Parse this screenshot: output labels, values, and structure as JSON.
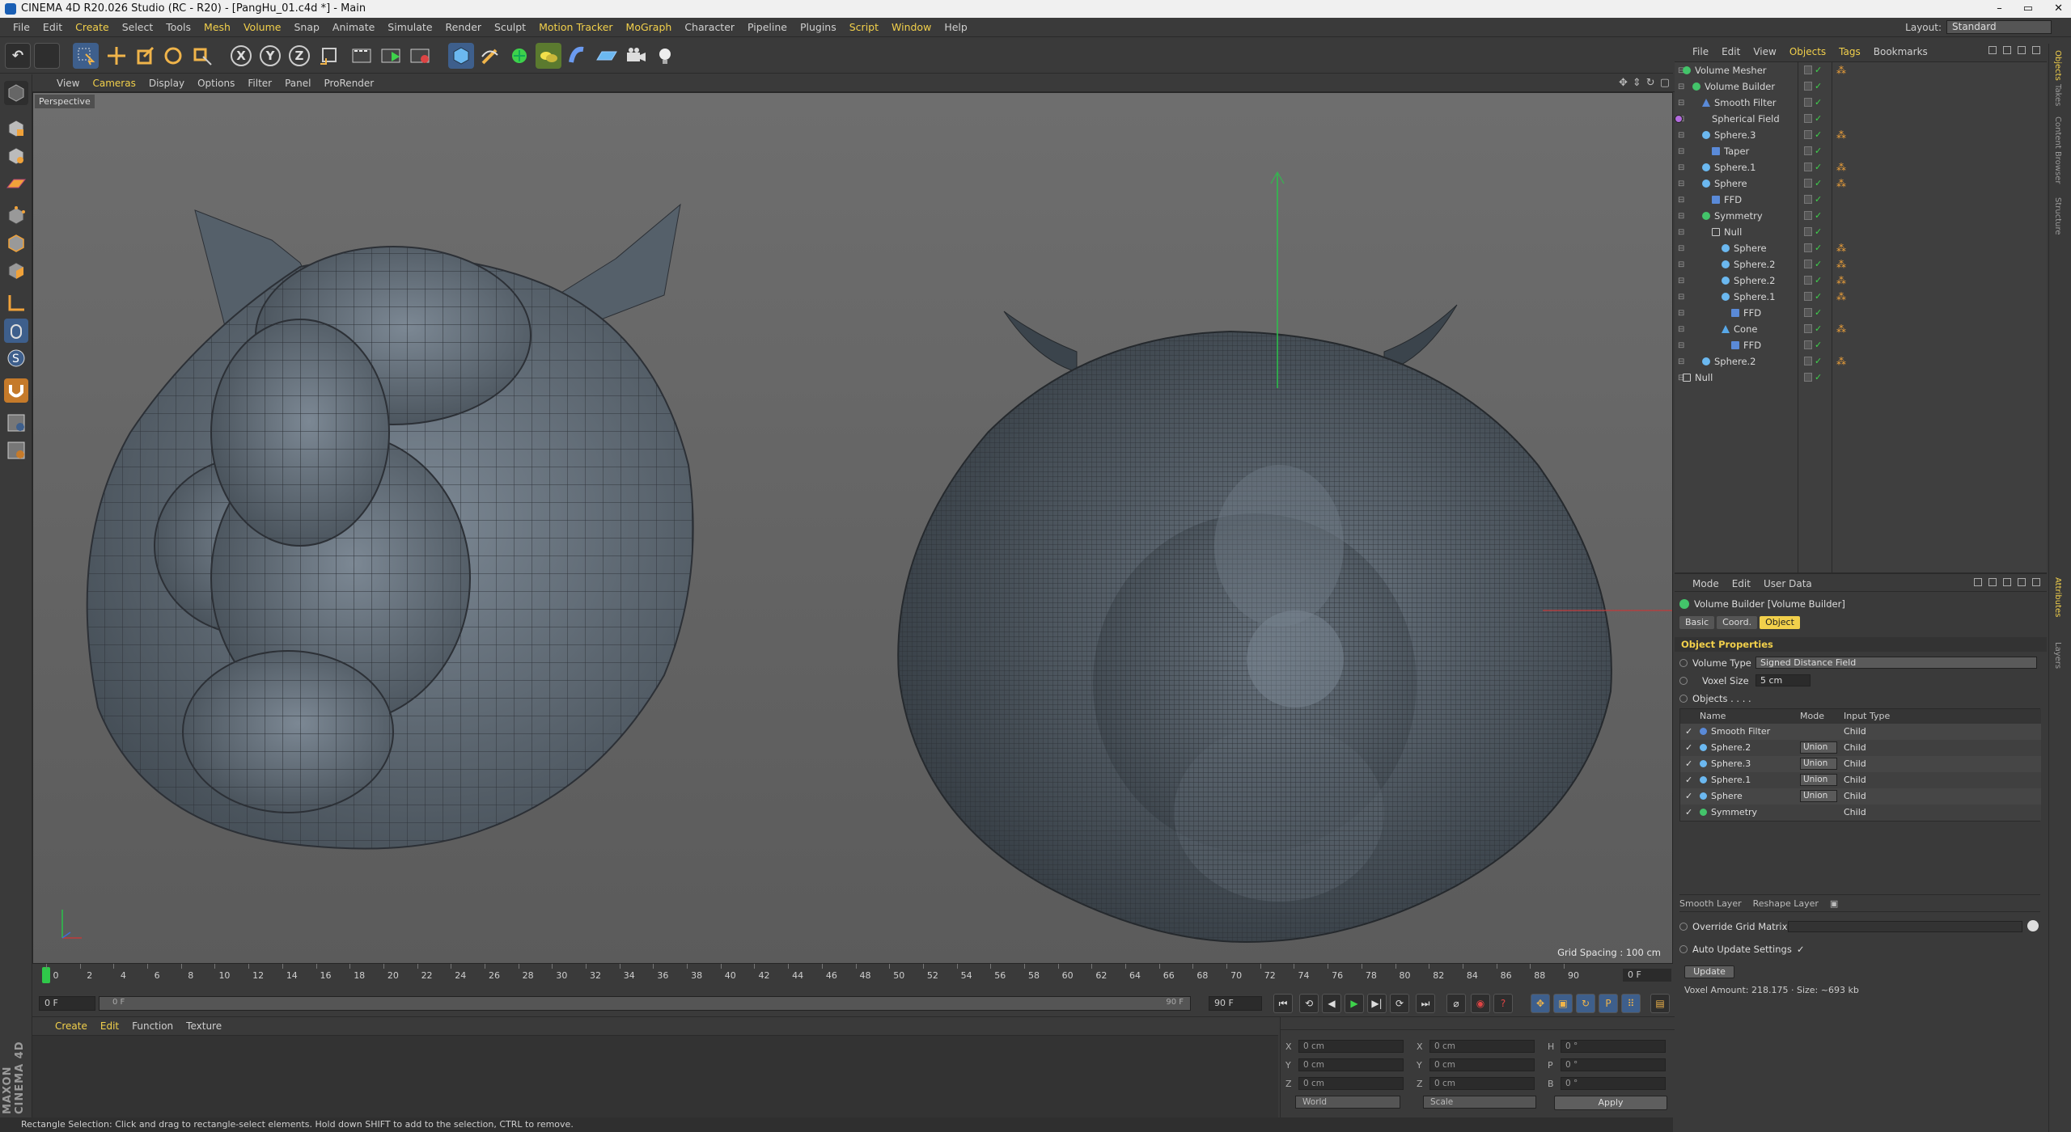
{
  "window": {
    "title": "CINEMA 4D R20.026 Studio (RC - R20) - [PangHu_01.c4d *] - Main",
    "controls": [
      "–",
      "▭",
      "✕"
    ]
  },
  "menu": {
    "items": [
      "File",
      "Edit",
      "Create",
      "Select",
      "Tools",
      "Mesh",
      "Volume",
      "Snap",
      "Animate",
      "Simulate",
      "Render",
      "Sculpt",
      "Motion Tracker",
      "MoGraph",
      "Character",
      "Pipeline",
      "Plugins",
      "Script",
      "Window",
      "Help"
    ],
    "highlighted": [
      "Create",
      "Mesh",
      "Volume",
      "Motion Tracker",
      "MoGraph",
      "Script",
      "Window"
    ],
    "layout_label": "Layout:",
    "layout_value": "Standard"
  },
  "toolbar": {
    "x_label": "X",
    "y_label": "Y",
    "z_label": "Z"
  },
  "viewport": {
    "menu": [
      "View",
      "Cameras",
      "Display",
      "Options",
      "Filter",
      "Panel",
      "ProRender"
    ],
    "camera": "Perspective",
    "grid_spacing": "Grid Spacing : 100 cm"
  },
  "timeline": {
    "ticks": [
      "0",
      "2",
      "4",
      "6",
      "8",
      "10",
      "12",
      "14",
      "16",
      "18",
      "20",
      "22",
      "24",
      "26",
      "28",
      "30",
      "32",
      "34",
      "36",
      "38",
      "40",
      "42",
      "44",
      "46",
      "48",
      "50",
      "52",
      "54",
      "56",
      "58",
      "60",
      "62",
      "64",
      "66",
      "68",
      "70",
      "72",
      "74",
      "76",
      "78",
      "80",
      "82",
      "84",
      "86",
      "88",
      "90"
    ],
    "current_frame": "0 F",
    "start_field": "0 F",
    "range_start": "0 F",
    "range_end": "90 F",
    "end_field": "90 F"
  },
  "material_manager": {
    "menu": [
      "Create",
      "Edit",
      "Function",
      "Texture"
    ]
  },
  "coordinates": {
    "pos": [
      {
        "axis": "X",
        "value": "0 cm"
      },
      {
        "axis": "Y",
        "value": "0 cm"
      },
      {
        "axis": "Z",
        "value": "0 cm"
      }
    ],
    "size": [
      {
        "axis": "X",
        "value": "0 cm"
      },
      {
        "axis": "Y",
        "value": "0 cm"
      },
      {
        "axis": "Z",
        "value": "0 cm"
      }
    ],
    "rot": [
      {
        "axis": "H",
        "value": "0 °"
      },
      {
        "axis": "P",
        "value": "0 °"
      },
      {
        "axis": "B",
        "value": "0 °"
      }
    ],
    "space": "World",
    "mode": "Scale",
    "apply_label": "Apply"
  },
  "status_text": "Rectangle Selection: Click and drag to rectangle-select elements. Hold down SHIFT to add to the selection, CTRL to remove.",
  "brand": "MAXON CINEMA 4D",
  "object_manager": {
    "menu": [
      "File",
      "Edit",
      "View",
      "Objects",
      "Tags",
      "Bookmarks"
    ],
    "objects": [
      {
        "name": "Volume Mesher",
        "icon": "green",
        "depth": 0,
        "tag": true
      },
      {
        "name": "Volume Builder",
        "icon": "green",
        "depth": 1,
        "tag": false
      },
      {
        "name": "Smooth Filter",
        "icon": "filter",
        "depth": 2,
        "tag": false
      },
      {
        "name": "Spherical Field",
        "icon": "field",
        "depth": 3,
        "tag": false
      },
      {
        "name": "Sphere.3",
        "icon": "sphere",
        "depth": 2,
        "tag": true
      },
      {
        "name": "Taper",
        "icon": "ffd",
        "depth": 3,
        "tag": false
      },
      {
        "name": "Sphere.1",
        "icon": "sphere",
        "depth": 2,
        "tag": true
      },
      {
        "name": "Sphere",
        "icon": "sphere",
        "depth": 2,
        "tag": true
      },
      {
        "name": "FFD",
        "icon": "ffd",
        "depth": 3,
        "tag": false
      },
      {
        "name": "Symmetry",
        "icon": "green",
        "depth": 2,
        "tag": false
      },
      {
        "name": "Null",
        "icon": "null",
        "depth": 3,
        "tag": false
      },
      {
        "name": "Sphere",
        "icon": "sphere",
        "depth": 4,
        "tag": true
      },
      {
        "name": "Sphere.2",
        "icon": "sphere",
        "depth": 4,
        "tag": true
      },
      {
        "name": "Sphere.2",
        "icon": "sphere",
        "depth": 4,
        "tag": true
      },
      {
        "name": "Sphere.1",
        "icon": "sphere",
        "depth": 4,
        "tag": true
      },
      {
        "name": "FFD",
        "icon": "ffd",
        "depth": 5,
        "tag": false
      },
      {
        "name": "Cone",
        "icon": "cone",
        "depth": 4,
        "tag": true
      },
      {
        "name": "FFD",
        "icon": "ffd",
        "depth": 5,
        "tag": false
      },
      {
        "name": "Sphere.2",
        "icon": "sphere",
        "depth": 2,
        "tag": true
      },
      {
        "name": "Null",
        "icon": "null",
        "depth": 0,
        "tag": false
      }
    ]
  },
  "right_tabs": [
    "Objects",
    "Takes",
    "Content Browser",
    "Structure",
    "Attributes",
    "Layers"
  ],
  "attributes": {
    "menu": [
      "Mode",
      "Edit",
      "User Data"
    ],
    "object_name": "Volume Builder [Volume Builder]",
    "tabs": [
      "Basic",
      "Coord.",
      "Object"
    ],
    "active_tab": "Object",
    "section": "Object Properties",
    "volume_type_label": "Volume Type",
    "volume_type_value": "Signed Distance Field",
    "voxel_size_label": "Voxel Size",
    "voxel_size_value": "5 cm",
    "objects_label": "Objects . . . .",
    "table_headers": [
      "Name",
      "Mode",
      "Input Type"
    ],
    "table_rows": [
      {
        "name": "Smooth Filter",
        "mode": "",
        "input": "Child",
        "icon": "filter"
      },
      {
        "name": "Sphere.2",
        "mode": "Union",
        "input": "Child",
        "icon": "sphere"
      },
      {
        "name": "Sphere.3",
        "mode": "Union",
        "input": "Child",
        "icon": "sphere"
      },
      {
        "name": "Sphere.1",
        "mode": "Union",
        "input": "Child",
        "icon": "sphere"
      },
      {
        "name": "Sphere",
        "mode": "Union",
        "input": "Child",
        "icon": "sphere"
      },
      {
        "name": "Symmetry",
        "mode": "",
        "input": "Child",
        "icon": "green"
      }
    ],
    "layer_buttons": [
      "Smooth Layer",
      "Reshape Layer"
    ],
    "override_label": "Override Grid Matrix",
    "auto_update_label": "Auto Update Settings",
    "auto_update_checked": true,
    "update_label": "Update",
    "voxel_amount": "Voxel Amount: 218.175 · Size: ~693 kb"
  }
}
